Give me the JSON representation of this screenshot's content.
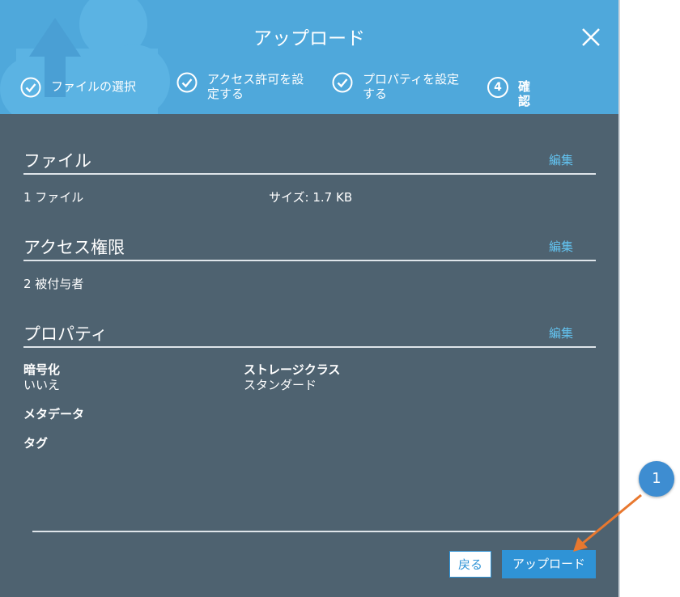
{
  "dialog": {
    "title": "アップロード",
    "close_icon": "close-icon",
    "steps": [
      {
        "label": "ファイルの選択",
        "state": "done"
      },
      {
        "label": "アクセス許可を設定する",
        "line1": "アクセス許可を設",
        "line2": "定する",
        "state": "done"
      },
      {
        "label": "プロパティを設定する",
        "line1": "プロパティを設定",
        "line2": "する",
        "state": "done"
      },
      {
        "number": "4",
        "label": "確認",
        "state": "current"
      }
    ]
  },
  "sections": {
    "files": {
      "title": "ファイル",
      "edit": "編集",
      "count": "1 ファイル",
      "size": "サイズ: 1.7 KB"
    },
    "access": {
      "title": "アクセス権限",
      "edit": "編集",
      "grantees": "2 被付与者"
    },
    "properties": {
      "title": "プロパティ",
      "edit": "編集",
      "encryption_label": "暗号化",
      "encryption_value": "いいえ",
      "storage_class_label": "ストレージクラス",
      "storage_class_value": "スタンダード",
      "metadata_label": "メタデータ",
      "tags_label": "タグ"
    }
  },
  "footer": {
    "back": "戻る",
    "upload": "アップロード"
  },
  "annotation": {
    "number": "1",
    "color": "#3e8dd1",
    "arrow_color": "#e8782f"
  },
  "colors": {
    "header": "#4fa8db",
    "body": "#4e6270",
    "primary_button": "#2f93d6",
    "edit_link": "#63c3f0"
  }
}
